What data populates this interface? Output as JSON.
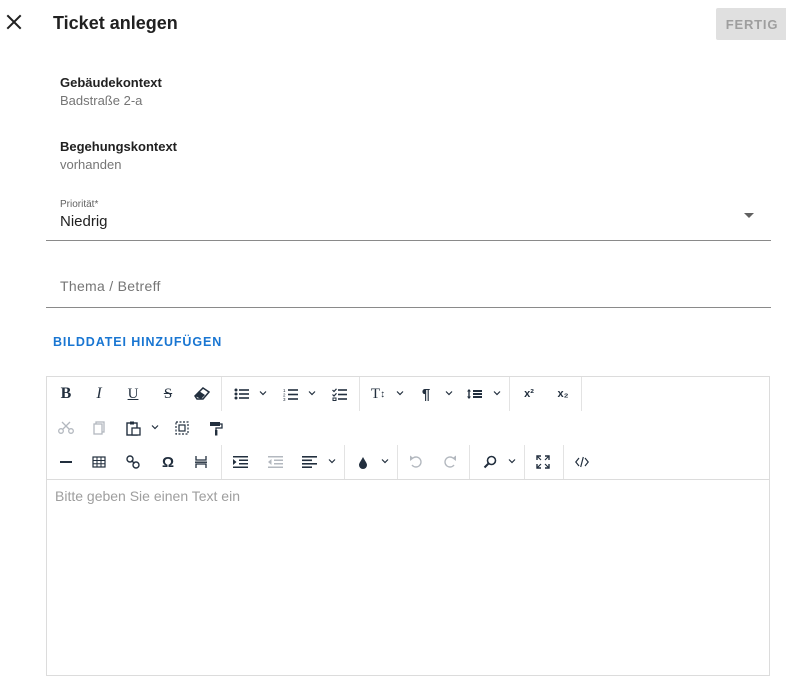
{
  "header": {
    "close_icon": "close-icon",
    "title": "Ticket anlegen",
    "done_label": "FERTIG"
  },
  "building_context": {
    "label": "Gebäudekontext",
    "value": "Badstraße 2-a"
  },
  "inspection_context": {
    "label": "Begehungskontext",
    "value": "vorhanden"
  },
  "priority": {
    "label": "Priorität*",
    "value": "Niedrig"
  },
  "subject": {
    "placeholder": "Thema / Betreff",
    "value": ""
  },
  "add_image_label": "BILDDATEI HINZUFÜGEN",
  "editor": {
    "placeholder": "Bitte geben Sie einen Text ein",
    "toolbar_row1": [
      "bold",
      "italic",
      "underline",
      "strikethrough",
      "remove-format",
      "bullet-list",
      "numbered-list",
      "checklist",
      "font-size",
      "paragraph",
      "line-height",
      "superscript",
      "subscript"
    ],
    "toolbar_row2": [
      "cut",
      "copy",
      "paste",
      "select-all",
      "format-painter"
    ],
    "toolbar_row3": [
      "horizontal-line",
      "table",
      "link",
      "special-character",
      "page-break",
      "indent",
      "outdent",
      "align",
      "text-color",
      "undo",
      "redo",
      "find-replace",
      "fullscreen",
      "source-code"
    ],
    "glyphs": {
      "bold": "B",
      "italic": "I",
      "underline": "U",
      "strikethrough": "S",
      "font_size": "T",
      "paragraph": "¶",
      "superscript": "x²",
      "subscript": "x₂",
      "special_character": "Ω"
    }
  },
  "colors": {
    "accent": "#1976d2",
    "done_bg": "#e0e0e0",
    "done_text": "#9e9e9e",
    "muted_text": "#757575"
  }
}
